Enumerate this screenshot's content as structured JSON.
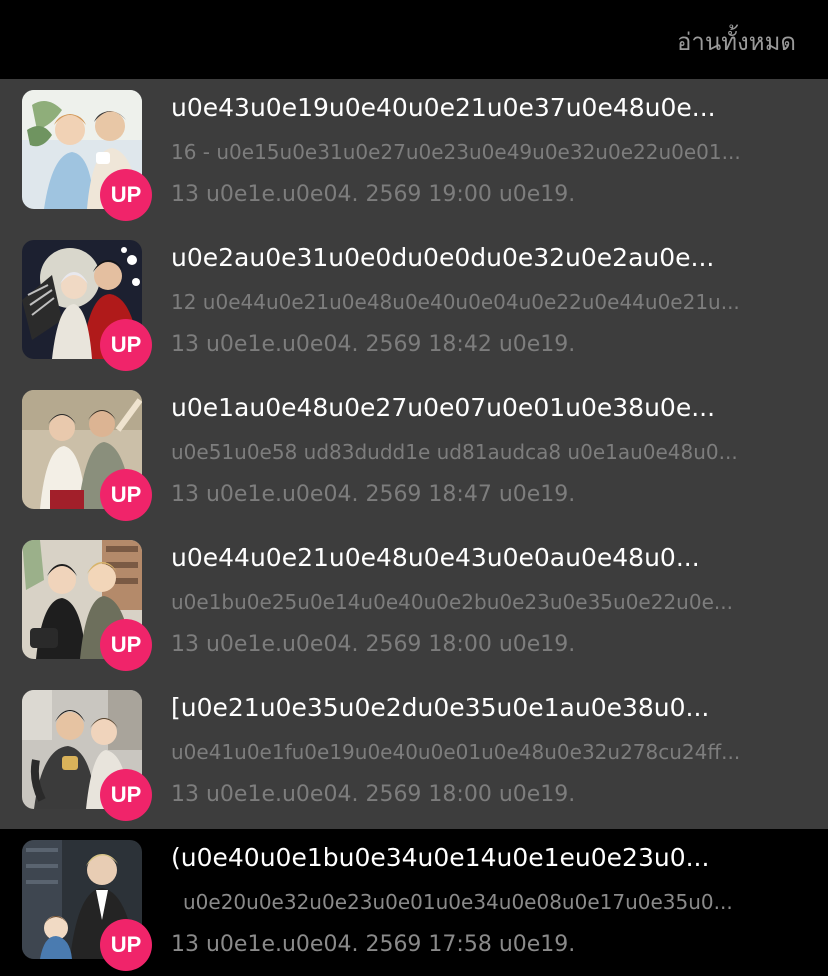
{
  "header": {
    "read_all_label": "อ่านทั้งหมด"
  },
  "badge_label": "UP",
  "items": [
    {
      "title": "u0e43u0e19u0e40u0e21u0e37u0e48u0e...",
      "subtitle": "16 - u0e15u0e31u0e27u0e23u0e49u0e32u0e22u0e01...",
      "time": "13 u0e1e.u0e04. 2569 19:00 u0e19."
    },
    {
      "title": "u0e2au0e31u0e0du0e0du0e32u0e2au0e...",
      "subtitle": "12 u0e44u0e21u0e48u0e40u0e04u0e22u0e44u0e21u...",
      "time": "13 u0e1e.u0e04. 2569 18:42 u0e19."
    },
    {
      "title": "u0e1au0e48u0e27u0e07u0e01u0e38u0e...",
      "subtitle": "u0e51u0e58 ud83dudd1e ud81audca8 u0e1au0e48u0...",
      "time": "13 u0e1e.u0e04. 2569 18:47 u0e19."
    },
    {
      "title": "u0e44u0e21u0e48u0e43u0e0au0e48u0...",
      "subtitle": "u0e1bu0e25u0e14u0e40u0e2bu0e23u0e35u0e22u0e...",
      "time": "13 u0e1e.u0e04. 2569 18:00 u0e19."
    },
    {
      "title": "[u0e21u0e35u0e2du0e35u0e1au0e38u0...",
      "subtitle": "u0e41u0e1fu0e19u0e40u0e01u0e48u0e32u278cu24ff...",
      "time": "13 u0e1e.u0e04. 2569 18:00 u0e19."
    },
    {
      "title": "(u0e40u0e1bu0e34u0e14u0e1eu0e23u0...",
      "subtitle": "u0e20u0e32u0e23u0e01u0e34u0e08u0e17u0e35u0...",
      "time": "13 u0e1e.u0e04. 2569 17:58 u0e19."
    }
  ]
}
